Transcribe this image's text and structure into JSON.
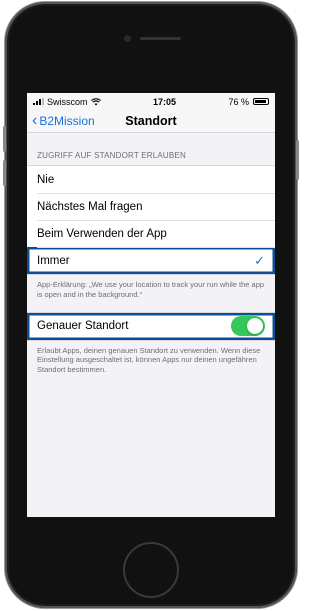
{
  "status_bar": {
    "carrier": "Swisscom",
    "time": "17:05",
    "battery": "76 %"
  },
  "nav": {
    "back_label": "B2Mission",
    "title": "Standort"
  },
  "access_section": {
    "header": "ZUGRIFF AUF STANDORT ERLAUBEN",
    "options": [
      {
        "label": "Nie",
        "selected": false
      },
      {
        "label": "Nächstes Mal fragen",
        "selected": false
      },
      {
        "label": "Beim Verwenden der App",
        "selected": false
      },
      {
        "label": "Immer",
        "selected": true
      }
    ],
    "checkmark": "✓",
    "explanation": "App-Erklärung: „We use your location to track your run while the app is open and in the background.“"
  },
  "precise_section": {
    "label": "Genauer Standort",
    "toggle_on": true,
    "description": "Erlaubt Apps, deinen genauen Standort zu verwenden. Wenn diese Einstellung ausgeschaltet ist, können Apps nur deinen ungefähren Standort bestimmen."
  },
  "colors": {
    "accent": "#1a6fe0",
    "toggle_on": "#34c759",
    "highlight_border": "#0d4f95",
    "background": "#f2f2f7"
  }
}
